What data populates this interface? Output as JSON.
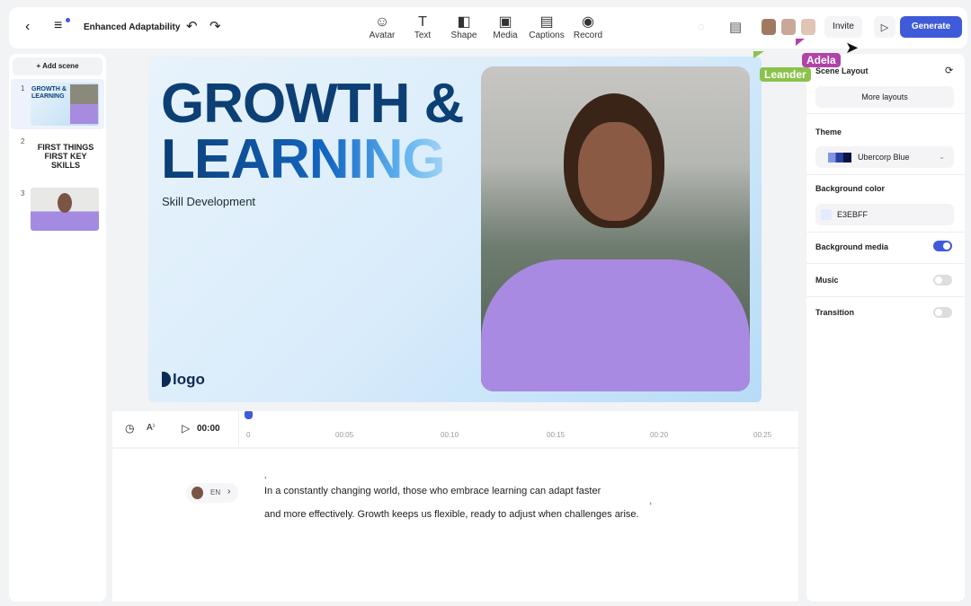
{
  "header": {
    "title": "Enhanced Adaptability",
    "tools": [
      {
        "label": "Avatar",
        "icon": "☺"
      },
      {
        "label": "Text",
        "icon": "T"
      },
      {
        "label": "Shape",
        "icon": "◧"
      },
      {
        "label": "Media",
        "icon": "▣"
      },
      {
        "label": "Captions",
        "icon": "▤"
      },
      {
        "label": "Record",
        "icon": "◉"
      }
    ],
    "invite": "Invite",
    "generate": "Generate",
    "accent": "#3f5bd9"
  },
  "collaborators": [
    {
      "name": "Leander",
      "color": "#8bc34a"
    },
    {
      "name": "Adela",
      "color": "#b043a8"
    }
  ],
  "scenes": {
    "add_label": "Add scene",
    "items": [
      {
        "num": "1",
        "title": "GROWTH & LEARNING"
      },
      {
        "num": "2",
        "title": "FIRST THINGS FIRST KEY SKILLS"
      },
      {
        "num": "3"
      }
    ]
  },
  "slide": {
    "title_line1": "GROWTH &",
    "title_line2": "LEARNING",
    "subtitle": "Skill Development",
    "logo": "logo"
  },
  "panel": {
    "scene_layout": "Scene Layout",
    "more_layouts": "More layouts",
    "theme_label": "Theme",
    "theme_value": "Ubercorp Blue",
    "bg_color_label": "Background color",
    "bg_color_value": "E3EBFF",
    "bg_media_label": "Background media",
    "bg_media_on": true,
    "music_label": "Music",
    "music_on": false,
    "transition_label": "Transition",
    "transition_on": false
  },
  "timeline": {
    "time": "00:00",
    "ticks": [
      "0",
      "00:05",
      "00:10",
      "00:15",
      "00:20",
      "00:25"
    ]
  },
  "script": {
    "lang": "EN",
    "line1": "In a constantly changing world, those who embrace learning can adapt faster",
    "line2": "and more effectively. Growth keeps us flexible, ready to adjust when challenges arise."
  }
}
